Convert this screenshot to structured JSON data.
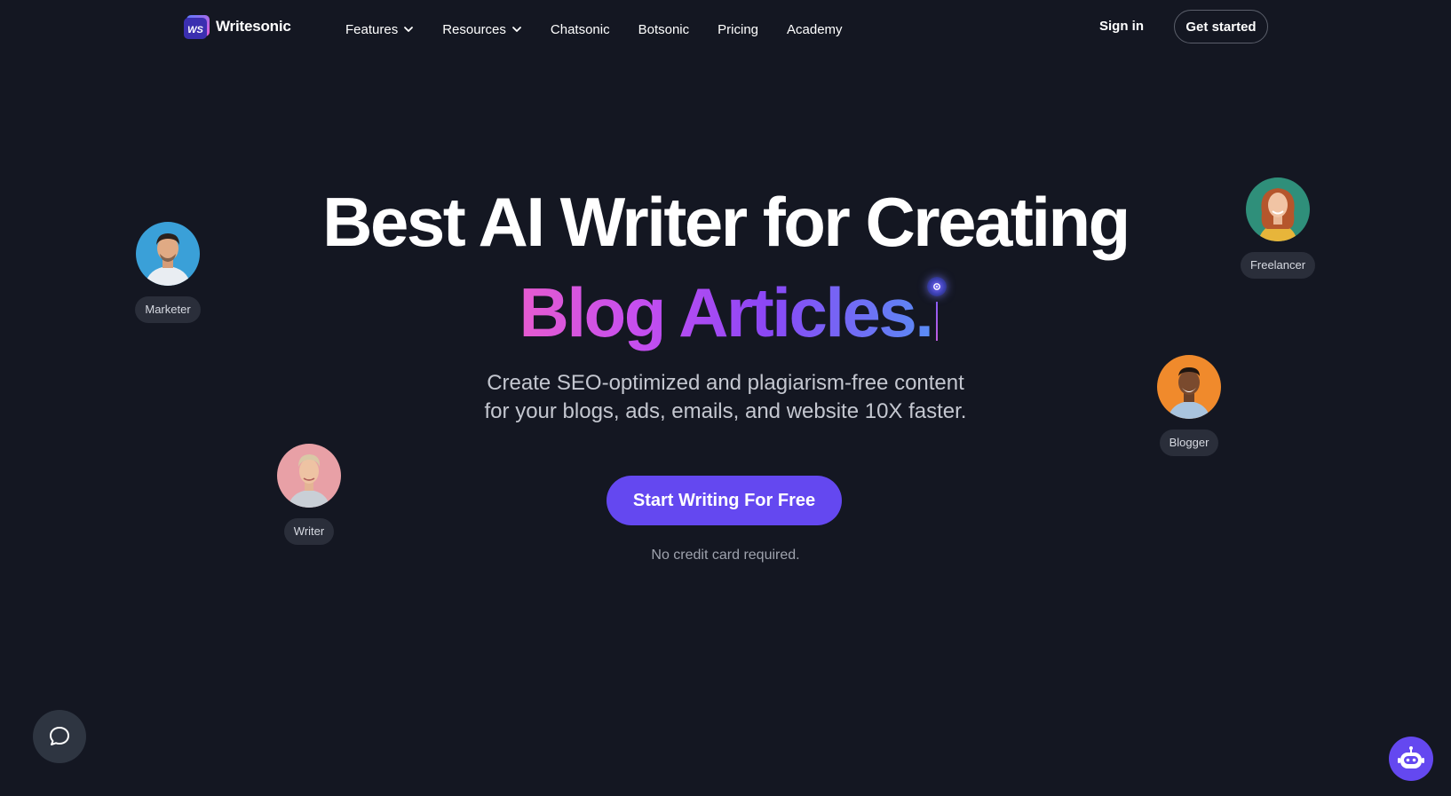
{
  "brand": {
    "name": "Writesonic",
    "logo_mark": "WS",
    "accent_color": "#6448f0",
    "background_color": "#141722"
  },
  "nav": {
    "items": [
      {
        "label": "Features",
        "has_dropdown": true
      },
      {
        "label": "Resources",
        "has_dropdown": true
      },
      {
        "label": "Chatsonic",
        "has_dropdown": false
      },
      {
        "label": "Botsonic",
        "has_dropdown": false
      },
      {
        "label": "Pricing",
        "has_dropdown": false
      },
      {
        "label": "Academy",
        "has_dropdown": false
      }
    ],
    "sign_in": "Sign in",
    "get_started": "Get started"
  },
  "hero": {
    "title_line1": "Best AI Writer for Creating",
    "title_line2": "Blog Articles.",
    "subtitle_line1": "Create SEO-optimized and plagiarism-free content",
    "subtitle_line2": "for your blogs, ads, emails, and website 10X faster.",
    "cta_label": "Start Writing For Free",
    "note": "No credit card required."
  },
  "personas": [
    {
      "label": "Marketer",
      "bg": "#3aa0d8"
    },
    {
      "label": "Writer",
      "bg": "#e8a0a6"
    },
    {
      "label": "Freelancer",
      "bg": "#2f8f7a"
    },
    {
      "label": "Blogger",
      "bg": "#f08a2c"
    }
  ],
  "widgets": {
    "chat_icon": "chat-bubble-icon",
    "bot_icon": "robot-icon"
  }
}
